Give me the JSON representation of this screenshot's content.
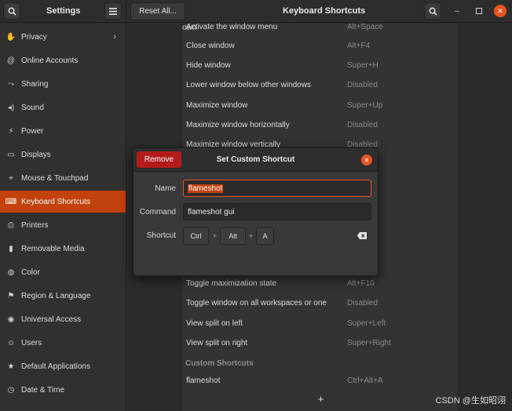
{
  "header": {
    "settings_title": "Settings",
    "reset_label": "Reset All...",
    "page_title": "Keyboard Shortcuts"
  },
  "sidebar": {
    "items": [
      {
        "label": "Privacy",
        "icon": "hand-icon"
      },
      {
        "label": "Online Accounts",
        "icon": "at-icon"
      },
      {
        "label": "Sharing",
        "icon": "share-icon"
      },
      {
        "label": "Sound",
        "icon": "speaker-icon"
      },
      {
        "label": "Power",
        "icon": "power-icon"
      },
      {
        "label": "Displays",
        "icon": "monitor-icon"
      },
      {
        "label": "Mouse & Touchpad",
        "icon": "mouse-icon"
      },
      {
        "label": "Keyboard Shortcuts",
        "icon": "keyboard-icon",
        "active": true
      },
      {
        "label": "Printers",
        "icon": "printer-icon"
      },
      {
        "label": "Removable Media",
        "icon": "usb-icon"
      },
      {
        "label": "Color",
        "icon": "palette-icon"
      },
      {
        "label": "Region & Language",
        "icon": "flag-icon"
      },
      {
        "label": "Universal Access",
        "icon": "accessibility-icon"
      },
      {
        "label": "Users",
        "icon": "users-icon"
      },
      {
        "label": "Default Applications",
        "icon": "star-icon"
      },
      {
        "label": "Date & Time",
        "icon": "clock-icon"
      }
    ]
  },
  "shortcuts": {
    "rows": [
      {
        "name": "Activate the window menu",
        "accel": "Alt+Space"
      },
      {
        "name": "Close window",
        "accel": "Alt+F4"
      },
      {
        "name": "Hide window",
        "accel": "Super+H"
      },
      {
        "name": "Lower window below other windows",
        "accel": "Disabled"
      },
      {
        "name": "Maximize window",
        "accel": "Super+Up"
      },
      {
        "name": "Maximize window horizontally",
        "accel": "Disabled"
      },
      {
        "name": "Maximize window vertically",
        "accel": "Disabled"
      },
      {
        "name": "Toggle maximization state",
        "accel": "Alt+F10"
      },
      {
        "name": "Toggle window on all workspaces or one",
        "accel": "Disabled"
      },
      {
        "name": "View split on left",
        "accel": "Super+Left"
      },
      {
        "name": "View split on right",
        "accel": "Super+Right"
      }
    ],
    "partial_accel": "own",
    "custom_section": "Custom Shortcuts",
    "custom_rows": [
      {
        "name": "flameshot",
        "accel": "Ctrl+Alt+A"
      }
    ],
    "add_label": "+"
  },
  "dialog": {
    "remove_label": "Remove",
    "title": "Set Custom Shortcut",
    "name_label": "Name",
    "name_value": "flameshot",
    "command_label": "Command",
    "command_value": "flameshot gui",
    "shortcut_label": "Shortcut",
    "keys": [
      "Ctrl",
      "Alt",
      "A"
    ],
    "plus": "+"
  },
  "watermark": "CSDN @生如昭诩",
  "colors": {
    "accent": "#e95420",
    "remove": "#b31b1b"
  }
}
